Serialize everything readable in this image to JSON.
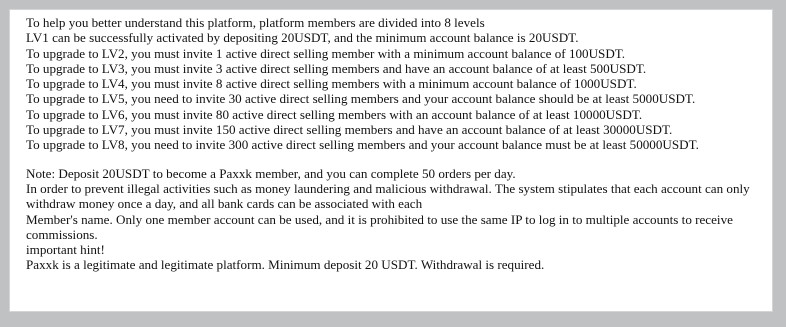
{
  "levels_text": [
    "To help you better understand this platform, platform members are divided into 8 levels",
    "LV1 can be successfully activated by depositing 20USDT, and the minimum account balance is 20USDT.",
    "To upgrade to LV2, you must invite 1 active direct selling member with a minimum account balance of 100USDT.",
    "To upgrade to LV3, you must invite 3 active direct selling members and have an account balance of at least 500USDT.",
    "To upgrade to LV4, you must invite 8 active direct selling members with a minimum account balance of 1000USDT.",
    "To upgrade to LV5, you need to invite 30 active direct selling members and your account balance should be at least 5000USDT.",
    "To upgrade to LV6, you must invite 80 active direct selling members with an account balance of at least 10000USDT.",
    "To upgrade to LV7, you must invite 150 active direct selling members and have an account balance of at least 30000USDT.",
    "To upgrade to LV8, you need to invite 300 active direct selling members and your account balance must be at least 50000USDT."
  ],
  "notes_text": [
    "Note: Deposit 20USDT to become a Paxxk member, and you can complete 50 orders per day.",
    "In order to prevent illegal activities such as money laundering and malicious withdrawal. The system stipulates that each account can only withdraw money once a day, and all bank cards can be associated with each",
    "Member's name. Only one member account can be used, and it is prohibited to use the same IP to log in to multiple accounts to receive commissions.",
    "important hint!",
    "Paxxk is a legitimate and legitimate platform. Minimum deposit 20 USDT. Withdrawal is required."
  ]
}
